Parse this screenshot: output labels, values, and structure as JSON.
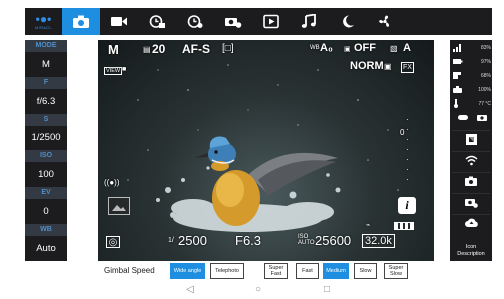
{
  "app": {
    "logo_text": "MIRACL"
  },
  "tabs": [
    {
      "name": "camera",
      "icon": "camera-icon",
      "active": true
    },
    {
      "name": "video",
      "icon": "video-camera-icon",
      "active": false
    },
    {
      "name": "timelapse",
      "icon": "timelapse-icon",
      "active": false
    },
    {
      "name": "timer",
      "icon": "timer-icon",
      "active": false
    },
    {
      "name": "photo-timer",
      "icon": "camera-timer-icon",
      "active": false
    },
    {
      "name": "playback",
      "icon": "play-icon",
      "active": false
    },
    {
      "name": "music",
      "icon": "music-note-icon",
      "active": false
    },
    {
      "name": "night",
      "icon": "moon-icon",
      "active": false
    },
    {
      "name": "fan",
      "icon": "fan-icon",
      "active": false
    }
  ],
  "settings": [
    {
      "label": "MODE",
      "value": "M"
    },
    {
      "label": "F",
      "value": "f/6.3"
    },
    {
      "label": "S",
      "value": "1/2500"
    },
    {
      "label": "ISO",
      "value": "100"
    },
    {
      "label": "EV",
      "value": "0"
    },
    {
      "label": "WB",
      "value": "Auto"
    }
  ],
  "liveview": {
    "mode": "M",
    "shots_remaining": "20",
    "af_mode": "AF-S",
    "af_area": "[□]",
    "wb_indicator": "A₀",
    "drive_mode": "OFF",
    "image_size": "A",
    "quality": "NORM",
    "fx_label": "FX",
    "view_label": "VIEW",
    "shutter": "2500",
    "aperture": "F6.3",
    "iso": "25600",
    "frames": "32.0k",
    "exposure_scale": "0",
    "info_button": "i"
  },
  "status": [
    {
      "icon": "signal-icon",
      "text": "83%"
    },
    {
      "icon": "battery-icon",
      "text": "97%"
    },
    {
      "icon": "storage-icon",
      "text": "68%"
    },
    {
      "icon": "camera-battery-icon",
      "text": "100%"
    },
    {
      "icon": "thermometer-icon",
      "text": "77 °C"
    }
  ],
  "right_buttons": [
    {
      "name": "fullscreen-button",
      "icon": "fullscreen-icon"
    },
    {
      "name": "wifi-button",
      "icon": "wifi-icon"
    },
    {
      "name": "capture-button",
      "icon": "camera-icon"
    },
    {
      "name": "camera-settings-button",
      "icon": "camera-gear-icon"
    },
    {
      "name": "upload-button",
      "icon": "cloud-upload-icon"
    }
  ],
  "icon_description": "Icon Description",
  "gimbal": {
    "label": "Gimbal Speed",
    "buttons": [
      {
        "label": "Wide angle",
        "active": true
      },
      {
        "label": "Telephoto",
        "active": false
      },
      {
        "label": "Super Fast",
        "active": false
      },
      {
        "label": "Fast",
        "active": false
      },
      {
        "label": "Medium",
        "active": true
      },
      {
        "label": "Slow",
        "active": false
      },
      {
        "label": "Super Slow",
        "active": false
      }
    ]
  },
  "system_nav": {
    "back": "◁",
    "home": "○",
    "recents": "□"
  },
  "colors": {
    "accent": "#1e8fe0",
    "panel": "#1c1c1e",
    "label_bg": "#343a44",
    "label_text": "#4f8ec7"
  }
}
